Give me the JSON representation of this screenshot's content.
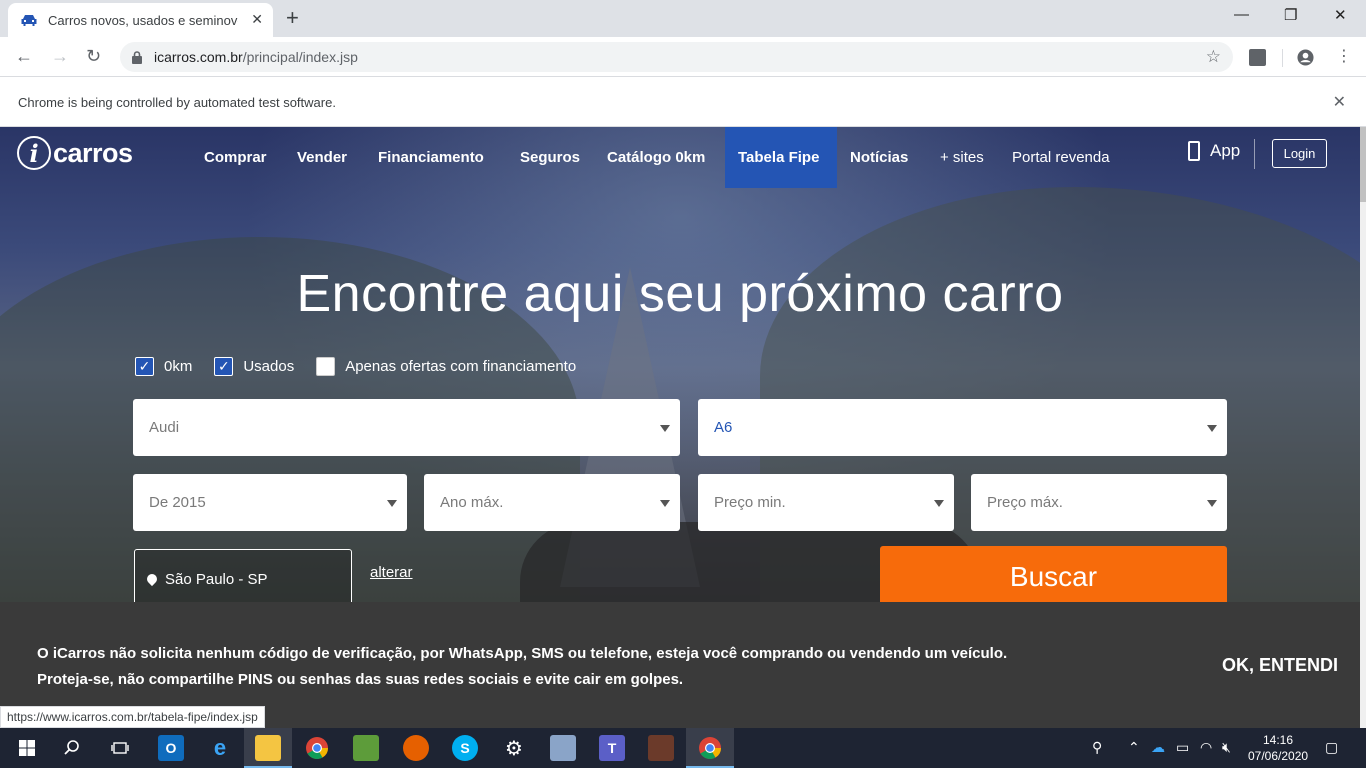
{
  "browser": {
    "tab_title": "Carros novos, usados e seminovo",
    "url_host": "icarros.com.br",
    "url_path": "/principal/index.jsp",
    "infobar_text": "Chrome is being controlled by automated test software.",
    "status_url": "https://www.icarros.com.br/tabela-fipe/index.jsp"
  },
  "site": {
    "logo_letter": "i",
    "logo_text": "carros",
    "nav": [
      {
        "label": "Comprar"
      },
      {
        "label": "Vender"
      },
      {
        "label": "Financiamento"
      },
      {
        "label": "Seguros"
      },
      {
        "label": "Catálogo 0km"
      },
      {
        "label": "Tabela Fipe",
        "active": true
      },
      {
        "label": "Notícias"
      },
      {
        "label": "+ sites"
      },
      {
        "label": "Portal revenda"
      }
    ],
    "app_label": "App",
    "login_label": "Login"
  },
  "search": {
    "headline": "Encontre aqui seu próximo carro",
    "checkboxes": [
      {
        "label": "0km",
        "checked": true
      },
      {
        "label": "Usados",
        "checked": true
      },
      {
        "label": "Apenas ofertas com financiamento",
        "checked": false
      }
    ],
    "brand": "Audi",
    "model": "A6",
    "year_min": "De 2015",
    "year_max": "Ano máx.",
    "price_min": "Preço min.",
    "price_max": "Preço máx.",
    "location": "São Paulo - SP",
    "change_location": "alterar",
    "submit": "Buscar"
  },
  "cookie_notice": {
    "line1": "O iCarros não solicita nenhum código de verificação, por WhatsApp, SMS ou telefone, esteja você comprando ou vendendo um veículo.",
    "line2": "Proteja-se, não compartilhe PINS ou senhas das suas redes sociais e evite cair em golpes.",
    "button": "OK, ENTENDI"
  },
  "taskbar": {
    "time": "14:16",
    "date": "07/06/2020"
  },
  "colors": {
    "brand_blue": "#2455b4",
    "buscar_orange": "#f76b0b",
    "notice_bg": "#3a3a3a"
  }
}
